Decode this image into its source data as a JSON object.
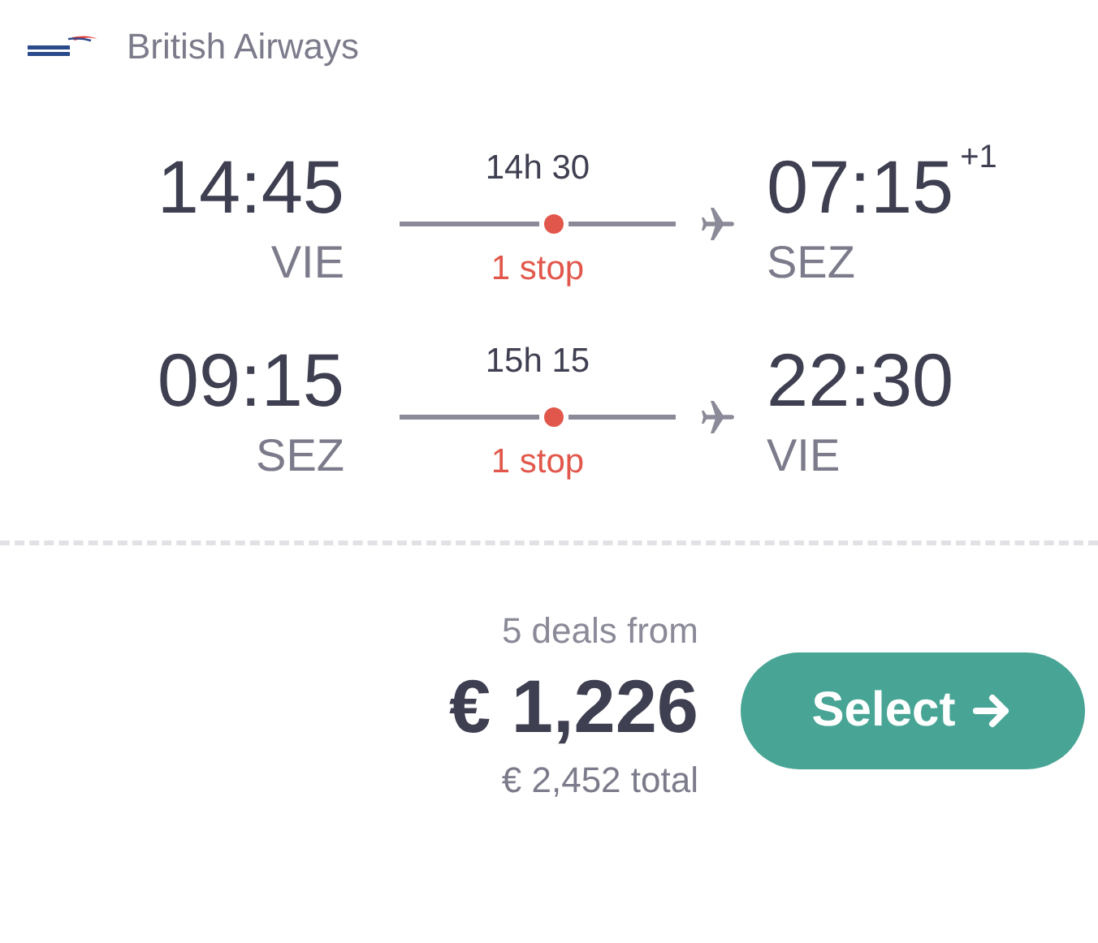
{
  "airline": {
    "name": "British Airways"
  },
  "legs": [
    {
      "depart_time": "14:45",
      "depart_code": "VIE",
      "duration": "14h 30",
      "stops": "1 stop",
      "arrive_time": "07:15",
      "day_offset": "+1",
      "arrive_code": "SEZ"
    },
    {
      "depart_time": "09:15",
      "depart_code": "SEZ",
      "duration": "15h 15",
      "stops": "1 stop",
      "arrive_time": "22:30",
      "arrive_code": "VIE"
    }
  ],
  "price": {
    "deals": "5 deals from",
    "amount": "€ 1,226",
    "total": "€ 2,452 total"
  },
  "select_button": {
    "label": "Select"
  }
}
